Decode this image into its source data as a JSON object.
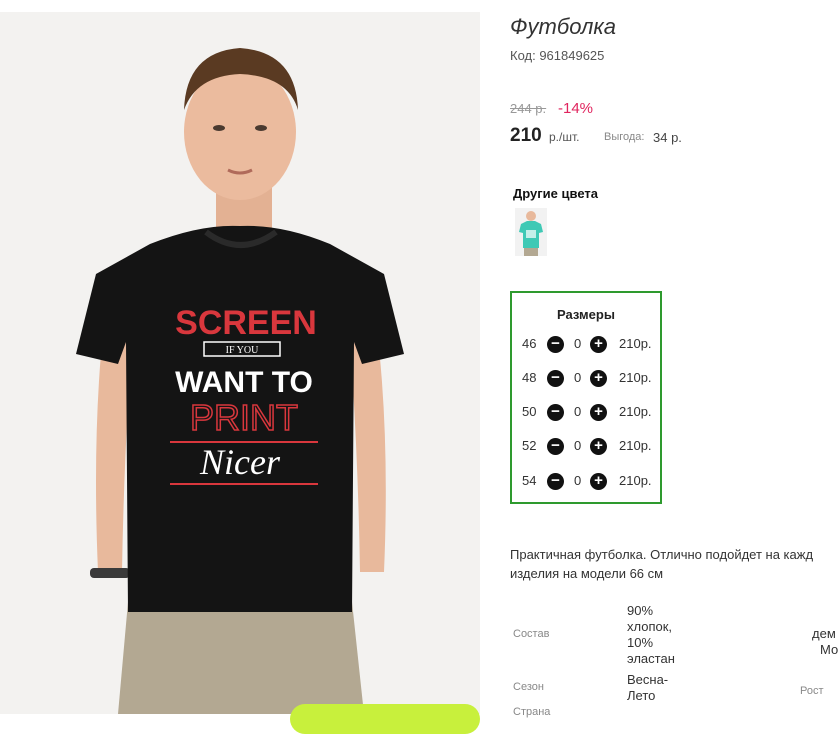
{
  "product": {
    "title": "Футболка",
    "code_text": "Код: 961849625",
    "old_price": "244 р.",
    "discount": "-14%",
    "price": "210",
    "price_unit": "р./шт.",
    "benefit_label": "Выгода:",
    "benefit_value": "34 р."
  },
  "colors": {
    "title": "Другие цвета",
    "swatch_color": "#3fc9b5"
  },
  "sizes": {
    "title": "Размеры",
    "rows": [
      {
        "size": "46",
        "qty": "0",
        "price": "210р."
      },
      {
        "size": "48",
        "qty": "0",
        "price": "210р."
      },
      {
        "size": "50",
        "qty": "0",
        "price": "210р."
      },
      {
        "size": "52",
        "qty": "0",
        "price": "210р."
      },
      {
        "size": "54",
        "qty": "0",
        "price": "210р."
      }
    ],
    "minus_icon": "minus-circle-icon",
    "plus_icon": "plus-circle-icon"
  },
  "description": {
    "line1": "Практичная футболка. Отлично подойдет на кажд",
    "line2": "изделия на модели 66 см"
  },
  "specs": {
    "composition_label": "Состав",
    "composition_value": [
      "90%",
      "хлопок,",
      "10%",
      "эластан"
    ],
    "season_label": "Сезон",
    "season_value": [
      "Весна-",
      "Лето"
    ],
    "country_label": "Страна",
    "right_top": [
      "дем",
      "Мо"
    ],
    "height_label": "Рост"
  },
  "shirt_print": {
    "line1": "SCREEN",
    "line2": "IF YOU",
    "line3": "WANT TO",
    "line4": "PRINT",
    "line5": "Nicer"
  },
  "colors_palette": {
    "accent_red": "#e0245e",
    "box_green": "#2e9a2e",
    "print_red": "#d9373d"
  }
}
